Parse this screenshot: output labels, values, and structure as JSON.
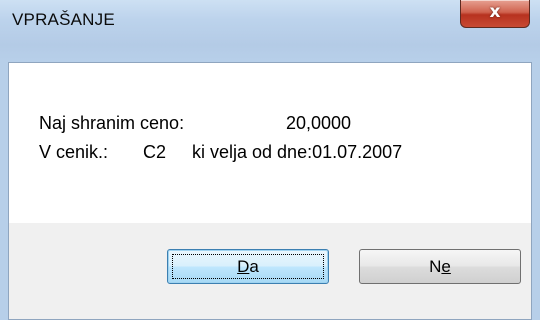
{
  "window": {
    "title": "VPRAŠANJE",
    "close_glyph": "x"
  },
  "message": {
    "line1_label": "Naj shranim ceno:",
    "line1_value": "20,0000",
    "line2_label": "V cenik.:",
    "line2_cenik": "C2",
    "line2_text": "ki velja od dne:01.07.2007"
  },
  "buttons": {
    "yes_underlined": "D",
    "yes_rest": "a",
    "no_first": "N",
    "no_underlined": "e"
  }
}
